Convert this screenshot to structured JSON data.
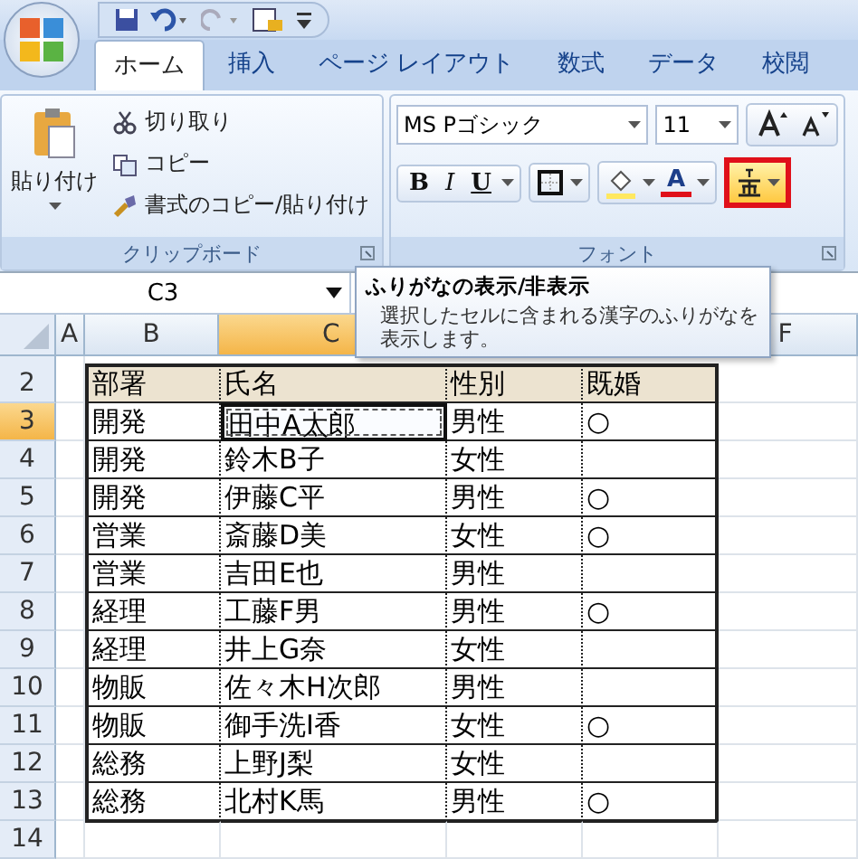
{
  "tabs": [
    {
      "label": "ホーム",
      "selected": true
    },
    {
      "label": "挿入",
      "selected": false
    },
    {
      "label": "ページ レイアウト",
      "selected": false
    },
    {
      "label": "数式",
      "selected": false
    },
    {
      "label": "データ",
      "selected": false
    },
    {
      "label": "校閲",
      "selected": false
    }
  ],
  "clipboard": {
    "paste": "貼り付け",
    "items": [
      "切り取り",
      "コピー",
      "書式のコピー/貼り付け"
    ],
    "label": "クリップボード"
  },
  "font": {
    "font_name": "MS Pゴシック",
    "font_size": "11",
    "bold": "B",
    "italic": "I",
    "underline": "U",
    "font_color": "A",
    "label": "フォント",
    "furigana_highlighted": true
  },
  "name_box": "C3",
  "tooltip": {
    "title": "ふりがなの表示/非表示",
    "body": "選択したセルに含まれる漢字のふりがなを表示します。"
  },
  "columns": [
    {
      "label": "A",
      "selected": false
    },
    {
      "label": "B",
      "selected": false
    },
    {
      "label": "C",
      "selected": true
    },
    {
      "label": "F",
      "selected": false
    }
  ],
  "rows": [
    {
      "number": "2",
      "kind": "header",
      "selected": false,
      "cells": [
        {
          "text": "部署",
          "selected": false
        },
        {
          "text": "氏名",
          "selected": false
        },
        {
          "text": "性別",
          "selected": false
        },
        {
          "text": "既婚",
          "selected": false
        }
      ]
    },
    {
      "number": "3",
      "kind": "data",
      "selected": true,
      "cells": [
        {
          "text": "開発",
          "selected": false
        },
        {
          "text": "田中A太郎",
          "selected": true
        },
        {
          "text": "男性",
          "selected": false
        },
        {
          "text": "○",
          "selected": false
        }
      ]
    },
    {
      "number": "4",
      "kind": "data",
      "selected": false,
      "cells": [
        {
          "text": "開発",
          "selected": false
        },
        {
          "text": "鈴木B子",
          "selected": false
        },
        {
          "text": "女性",
          "selected": false
        },
        {
          "selected": false
        }
      ]
    },
    {
      "number": "5",
      "kind": "data",
      "selected": false,
      "cells": [
        {
          "text": "開発",
          "selected": false
        },
        {
          "text": "伊藤C平",
          "selected": false
        },
        {
          "text": "男性",
          "selected": false
        },
        {
          "text": "○",
          "selected": false
        }
      ]
    },
    {
      "number": "6",
      "kind": "data",
      "selected": false,
      "cells": [
        {
          "text": "営業",
          "selected": false
        },
        {
          "text": "斎藤D美",
          "selected": false
        },
        {
          "text": "女性",
          "selected": false
        },
        {
          "text": "○",
          "selected": false
        }
      ]
    },
    {
      "number": "7",
      "kind": "data",
      "selected": false,
      "cells": [
        {
          "text": "営業",
          "selected": false
        },
        {
          "text": "吉田E也",
          "selected": false
        },
        {
          "text": "男性",
          "selected": false
        },
        {
          "selected": false
        }
      ]
    },
    {
      "number": "8",
      "kind": "data",
      "selected": false,
      "cells": [
        {
          "text": "経理",
          "selected": false
        },
        {
          "text": "工藤F男",
          "selected": false
        },
        {
          "text": "男性",
          "selected": false
        },
        {
          "text": "○",
          "selected": false
        }
      ]
    },
    {
      "number": "9",
      "kind": "data",
      "selected": false,
      "cells": [
        {
          "text": "経理",
          "selected": false
        },
        {
          "text": "井上G奈",
          "selected": false
        },
        {
          "text": "女性",
          "selected": false
        },
        {
          "selected": false
        }
      ]
    },
    {
      "number": "10",
      "kind": "data",
      "selected": false,
      "cells": [
        {
          "text": "物販",
          "selected": false
        },
        {
          "text": "佐々木H次郎",
          "selected": false
        },
        {
          "text": "男性",
          "selected": false
        },
        {
          "selected": false
        }
      ]
    },
    {
      "number": "11",
      "kind": "data",
      "selected": false,
      "cells": [
        {
          "text": "物販",
          "selected": false
        },
        {
          "text": "御手洗I香",
          "selected": false
        },
        {
          "text": "女性",
          "selected": false
        },
        {
          "text": "○",
          "selected": false
        }
      ]
    },
    {
      "number": "12",
      "kind": "data",
      "selected": false,
      "cells": [
        {
          "text": "総務",
          "selected": false
        },
        {
          "text": "上野J梨",
          "selected": false
        },
        {
          "text": "女性",
          "selected": false
        },
        {
          "selected": false
        }
      ]
    },
    {
      "number": "13",
      "kind": "data",
      "selected": false,
      "cells": [
        {
          "text": "総務",
          "selected": false
        },
        {
          "text": "北村K馬",
          "selected": false
        },
        {
          "text": "男性",
          "selected": false
        },
        {
          "text": "○",
          "selected": false
        }
      ]
    },
    {
      "number": "14",
      "kind": "blank",
      "selected": false
    }
  ]
}
